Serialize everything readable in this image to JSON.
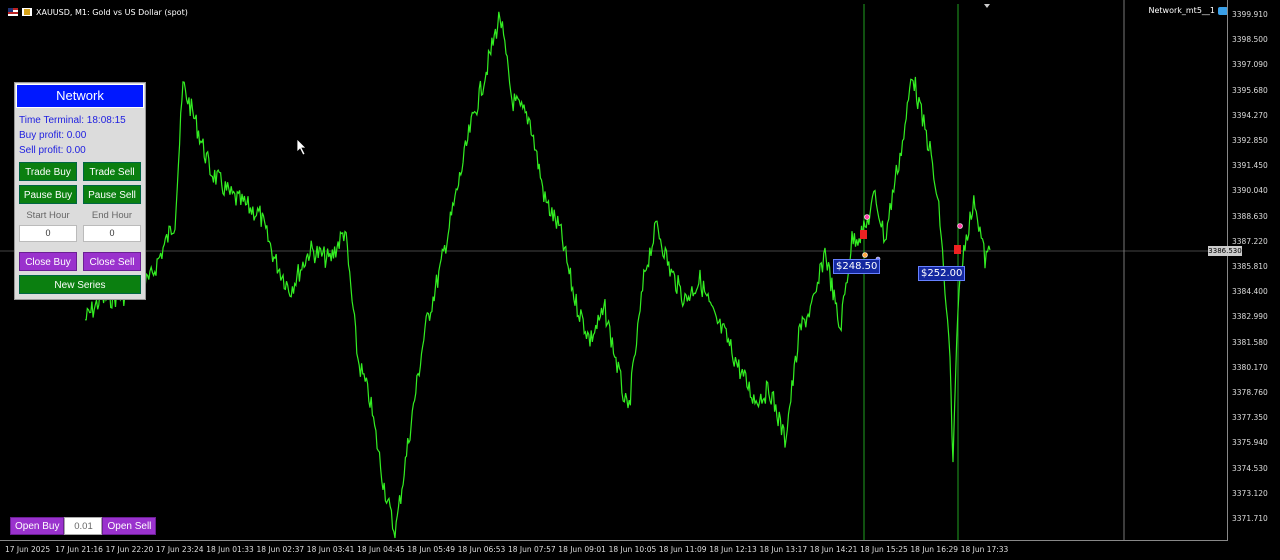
{
  "chart": {
    "title": "XAUUSD, M1:  Gold vs US Dollar (spot)",
    "expert_name": "Network_mt5__1",
    "current_price_label": "3386.530",
    "colors": {
      "line": "#33ee22",
      "vline": "#1fa11f",
      "bg": "#000000"
    },
    "price_labels": [
      "3399.910",
      "3398.500",
      "3397.090",
      "3395.680",
      "3394.270",
      "3392.850",
      "3391.450",
      "3390.040",
      "3388.630",
      "3387.220",
      "3385.810",
      "3384.400",
      "3382.990",
      "3381.580",
      "3380.170",
      "3378.760",
      "3377.350",
      "3375.940",
      "3374.530",
      "3373.120",
      "3371.710"
    ],
    "time_labels": [
      "17 Jun 2025",
      "17 Jun 21:16",
      "17 Jun 22:20",
      "17 Jun 23:24",
      "18 Jun 01:33",
      "18 Jun 02:37",
      "18 Jun 03:41",
      "18 Jun 04:45",
      "18 Jun 05:49",
      "18 Jun 06:53",
      "18 Jun 07:57",
      "18 Jun 09:01",
      "18 Jun 10:05",
      "18 Jun 11:09",
      "18 Jun 12:13",
      "18 Jun 13:17",
      "18 Jun 14:21",
      "18 Jun 15:25",
      "18 Jun 16:29",
      "18 Jun 17:33"
    ],
    "profit_tags": [
      "$248.50",
      "$252.00"
    ]
  },
  "panel": {
    "title": "Network",
    "time_terminal": "Time Terminal: 18:08:15",
    "buy_profit": "Buy profit: 0.00",
    "sell_profit": "Sell profit: 0.00",
    "trade_buy": "Trade Buy",
    "trade_sell": "Trade Sell",
    "pause_buy": "Pause Buy",
    "pause_sell": "Pause Sell",
    "start_hour_label": "Start Hour",
    "end_hour_label": "End Hour",
    "start_hour_value": "0",
    "end_hour_value": "0",
    "close_buy": "Close Buy",
    "close_sell": "Close Sell",
    "new_series": "New Series"
  },
  "order": {
    "open_buy": "Open Buy",
    "lot": "0.01",
    "open_sell": "Open Sell"
  }
}
